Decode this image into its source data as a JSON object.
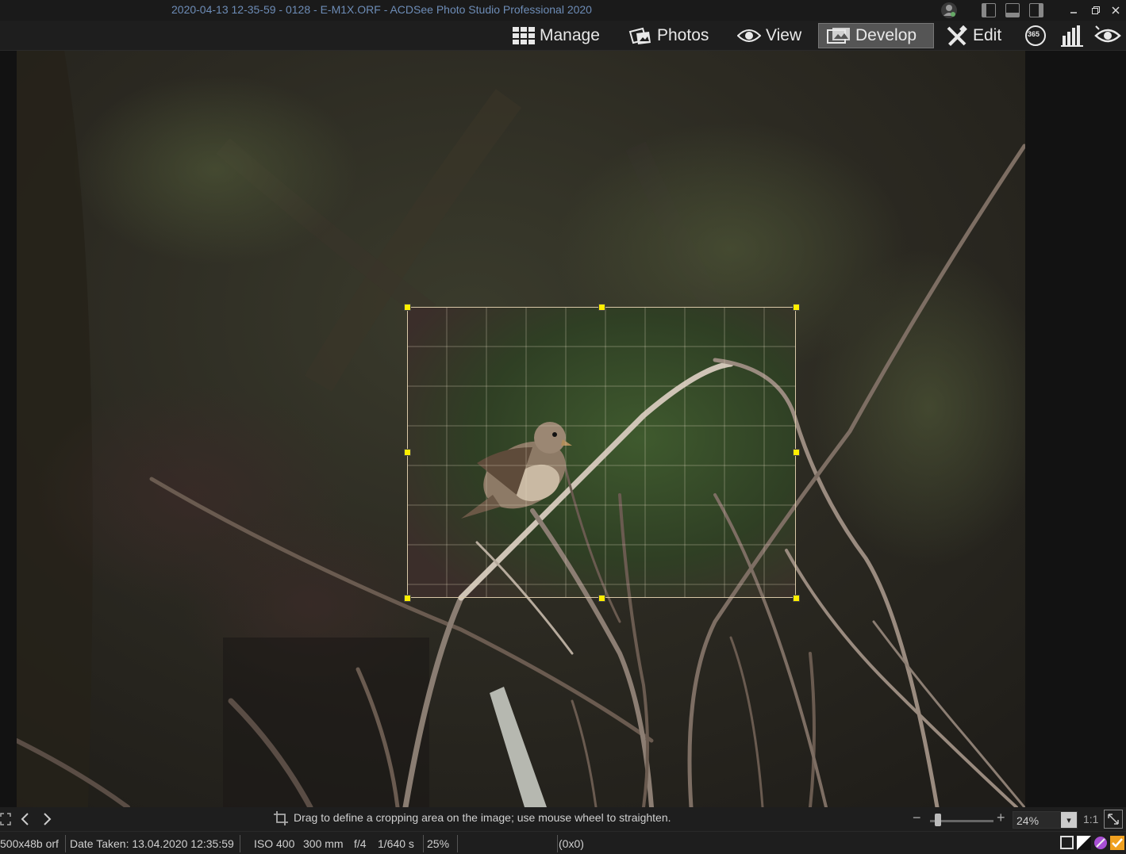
{
  "window": {
    "title": "2020-04-13 12-35-59 - 0128 - E-M1X.ORF - ACDSee Photo Studio Professional 2020"
  },
  "modes": {
    "manage": "Manage",
    "photos": "Photos",
    "view": "View",
    "develop": "Develop",
    "edit": "Edit",
    "active": "Develop"
  },
  "tools": {
    "badge_365": "365"
  },
  "colors": {
    "title_text": "#6d8cb6",
    "active_mode_bg": "#555555",
    "crop_handle": "#ffee00",
    "crop_border": "#d9c8a8"
  },
  "status": {
    "hint": "Drag to define a cropping area on the image; use mouse wheel to straighten.",
    "file_info": "500x48b orf",
    "date_taken": "Date Taken: 13.04.2020 12:35:59",
    "iso": "ISO 400",
    "focal_length": "300 mm",
    "aperture": "f/4",
    "shutter": "1/640 s",
    "zoom_pct": "25%",
    "coords": "(0x0)"
  },
  "zoom": {
    "value": "24%",
    "one_to_one": "1:1",
    "minus": "−",
    "plus": "+"
  }
}
